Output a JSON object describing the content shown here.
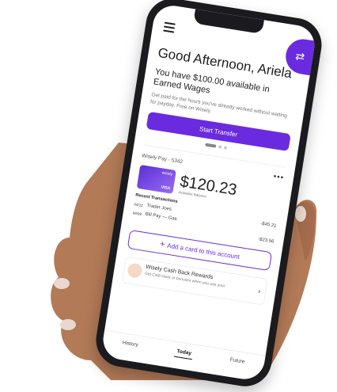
{
  "header": {
    "greeting": "Good Afternoon, Ariela",
    "available": "You have $100.00 available in Earned Wages",
    "subtext": "Get paid for the hours you've already worked without waiting for payday. Free on Wisely.",
    "start_transfer_label": "Start Transfer"
  },
  "icons": {
    "menu": "menu-icon",
    "transfer": "transfer-icon",
    "more": "more-icon",
    "chevron": "chevron-right-icon"
  },
  "card": {
    "title": "Wisely Pay - 5342",
    "card_brand": "wisely",
    "card_network": "VISA",
    "balance": "$120.23",
    "balance_label": "Available Balance",
    "recent_title": "Recent Transactions",
    "transactions": [
      {
        "date": "04/12",
        "merchant": "Trader Joes",
        "amount": "-$45.21"
      },
      {
        "date": "04/09",
        "merchant": "Bill Pay — Gas",
        "amount": ""
      }
    ],
    "extra_amount": "-$23.56"
  },
  "add_card": {
    "label": "Add a card to this account"
  },
  "cashback": {
    "title": "Wisely Cash Back Rewards",
    "subtitle": "Get Cash back or bonuses when you use your"
  },
  "tabs": [
    {
      "label": "History",
      "active": false
    },
    {
      "label": "Today",
      "active": true
    },
    {
      "label": "Future",
      "active": false
    }
  ],
  "colors": {
    "accent": "#6a2be0",
    "skin": "#b27a57"
  }
}
